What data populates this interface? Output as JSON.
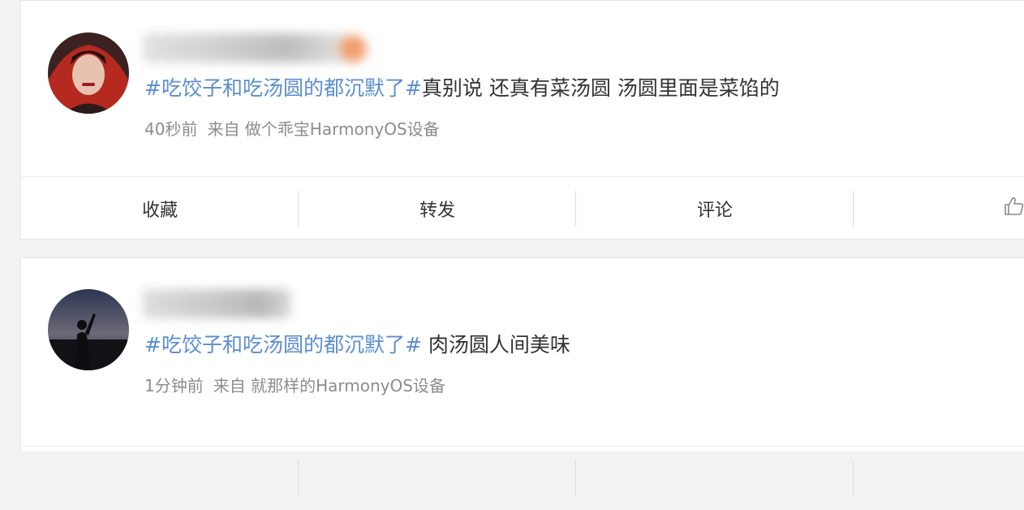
{
  "posts": [
    {
      "content_topic": "#吃饺子和吃汤圆的都沉默了#",
      "content_text": "真别说 还真有菜汤圆 汤圆里面是菜馅的",
      "time": "40秒前",
      "source": "来自 做个乖宝HarmonyOS设备"
    },
    {
      "content_topic": "#吃饺子和吃汤圆的都沉默了#",
      "content_text": " 肉汤圆人间美味",
      "time": "1分钟前",
      "source": "来自 就那样的HarmonyOS设备"
    }
  ],
  "actions": {
    "favorite": "收藏",
    "repost": "转发",
    "comment": "评论"
  },
  "colors": {
    "topic": "#5b8ed0",
    "background": "#f2f2f5",
    "meta": "#8c8c8c"
  },
  "icons": {
    "like": "thumbs-up-icon"
  }
}
